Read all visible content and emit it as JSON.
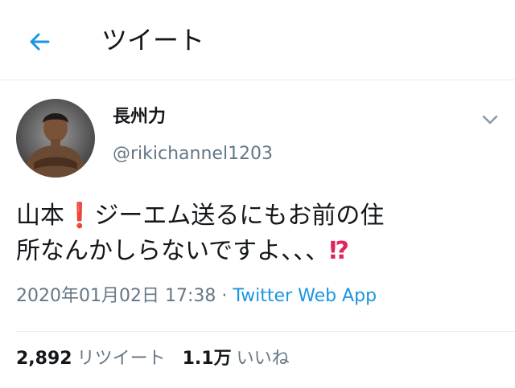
{
  "header": {
    "back_icon": "arrow-left-icon",
    "title": "ツイート",
    "accent_color": "#1b95e0"
  },
  "tweet": {
    "author": {
      "name": "長州力",
      "handle": "@rikichannel1203",
      "avatar": "avatar-photo"
    },
    "menu_icon": "chevron-down-icon",
    "text": {
      "line1_a": "山本",
      "line1_emoji": "❗",
      "line1_b": "ジーエム送るにもお前の住",
      "line2_a": "所なんかしらないですよ、、、",
      "line2_emoji": "⁉"
    },
    "timestamp": "2020年01月02日 17:38",
    "separator": "·",
    "source": "Twitter Web App",
    "stats": {
      "retweets_count": "2,892",
      "retweets_label": "リツイート",
      "likes_count": "1.1万",
      "likes_label": "いいね"
    }
  }
}
